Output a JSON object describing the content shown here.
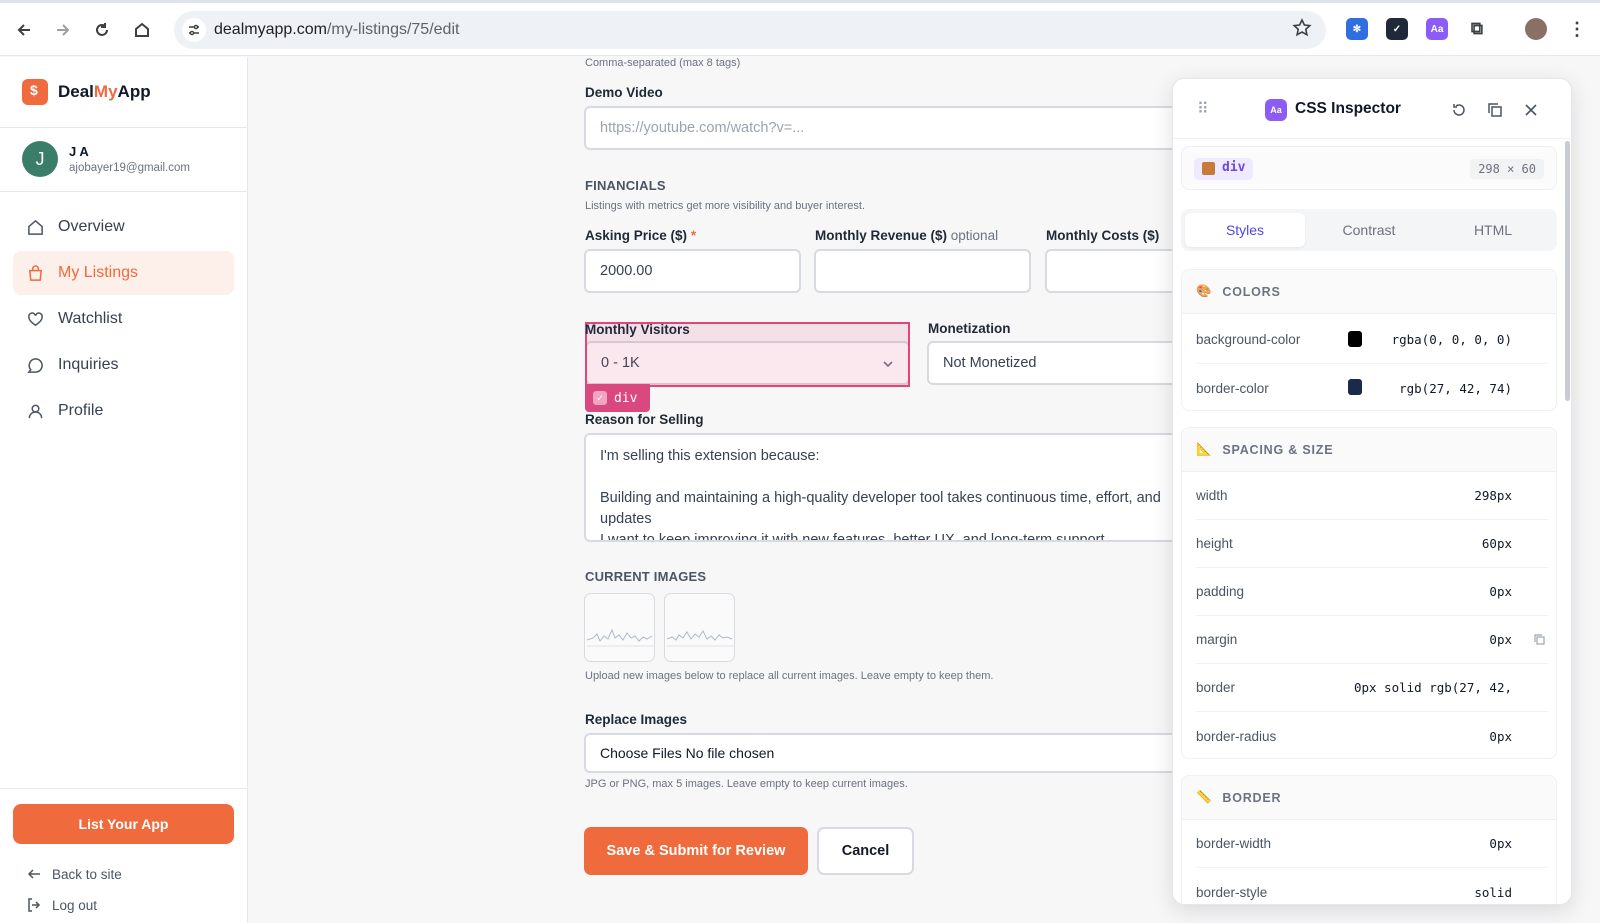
{
  "browser": {
    "url_domain": "dealmyapp.com",
    "url_path": "/my-listings/75/edit"
  },
  "sidebar": {
    "brand_deal": "Deal",
    "brand_my": "My",
    "brand_app": "App",
    "user_initial": "J",
    "user_name": "J A",
    "user_email": "ajobayer19@gmail.com",
    "nav": [
      {
        "label": "Overview",
        "icon": "home-icon"
      },
      {
        "label": "My Listings",
        "icon": "bag-icon",
        "active": true
      },
      {
        "label": "Watchlist",
        "icon": "heart-icon"
      },
      {
        "label": "Inquiries",
        "icon": "chat-icon"
      },
      {
        "label": "Profile",
        "icon": "user-icon"
      }
    ],
    "list_button": "List Your App",
    "back_link": "Back to site",
    "logout_link": "Log out"
  },
  "form": {
    "tags_hint": "Comma-separated (max 8 tags)",
    "demo_label": "Demo Video",
    "demo_placeholder": "https://youtube.com/watch?v=...",
    "financials_title": "FINANCIALS",
    "financials_hint": "Listings with metrics get more visibility and buyer interest.",
    "asking_label": "Asking Price ($)",
    "asking_required": "*",
    "asking_value": "2000.00",
    "revenue_label": "Monthly Revenue ($)",
    "revenue_optional": "optional",
    "revenue_value": "",
    "costs_label": "Monthly Costs ($)",
    "costs_value": "",
    "visitors_label": "Monthly Visitors",
    "visitors_value": "0 - 1K",
    "monetization_label": "Monetization",
    "monetization_value": "Not Monetized",
    "highlight_tag": "div",
    "reason_label": "Reason for Selling",
    "reason_line1": "I'm selling this extension because:",
    "reason_line2": "Building and maintaining a high-quality developer tool takes continuous time, effort, and",
    "reason_line3": "updates",
    "reason_line4": "I want to keep improving it with new features, better UX, and long-term support",
    "current_images_title": "CURRENT IMAGES",
    "upload_hint": "Upload new images below to replace all current images. Leave empty to keep them.",
    "replace_label": "Replace Images",
    "file_button": "Choose Files",
    "file_status": "No file chosen",
    "replace_hint": "JPG or PNG, max 5 images. Leave empty to keep current images.",
    "submit_button": "Save & Submit for Review",
    "cancel_button": "Cancel"
  },
  "inspector": {
    "title": "CSS Inspector",
    "logo_text": "Aa",
    "element_tag": "div",
    "element_dims": "298 × 60",
    "tabs": [
      "Styles",
      "Contrast",
      "HTML"
    ],
    "colors_title": "COLORS",
    "colors": [
      {
        "prop": "background-color",
        "value": "rgba(0, 0, 0, 0)",
        "swatch": "#000000"
      },
      {
        "prop": "border-color",
        "value": "rgb(27, 42, 74)",
        "swatch": "#1b2a4a"
      }
    ],
    "spacing_title": "SPACING & SIZE",
    "spacing": [
      {
        "prop": "width",
        "value": "298px"
      },
      {
        "prop": "height",
        "value": "60px"
      },
      {
        "prop": "padding",
        "value": "0px"
      },
      {
        "prop": "margin",
        "value": "0px"
      },
      {
        "prop": "border",
        "value": "0px solid rgb(27, 42, "
      },
      {
        "prop": "border-radius",
        "value": "0px"
      }
    ],
    "border_title": "BORDER",
    "border": [
      {
        "prop": "border-width",
        "value": "0px"
      },
      {
        "prop": "border-style",
        "value": "solid"
      }
    ]
  },
  "colors": {
    "accent": "#ef6a3c",
    "highlight": "#e0457b",
    "inspector_accent": "#4f46e5"
  }
}
